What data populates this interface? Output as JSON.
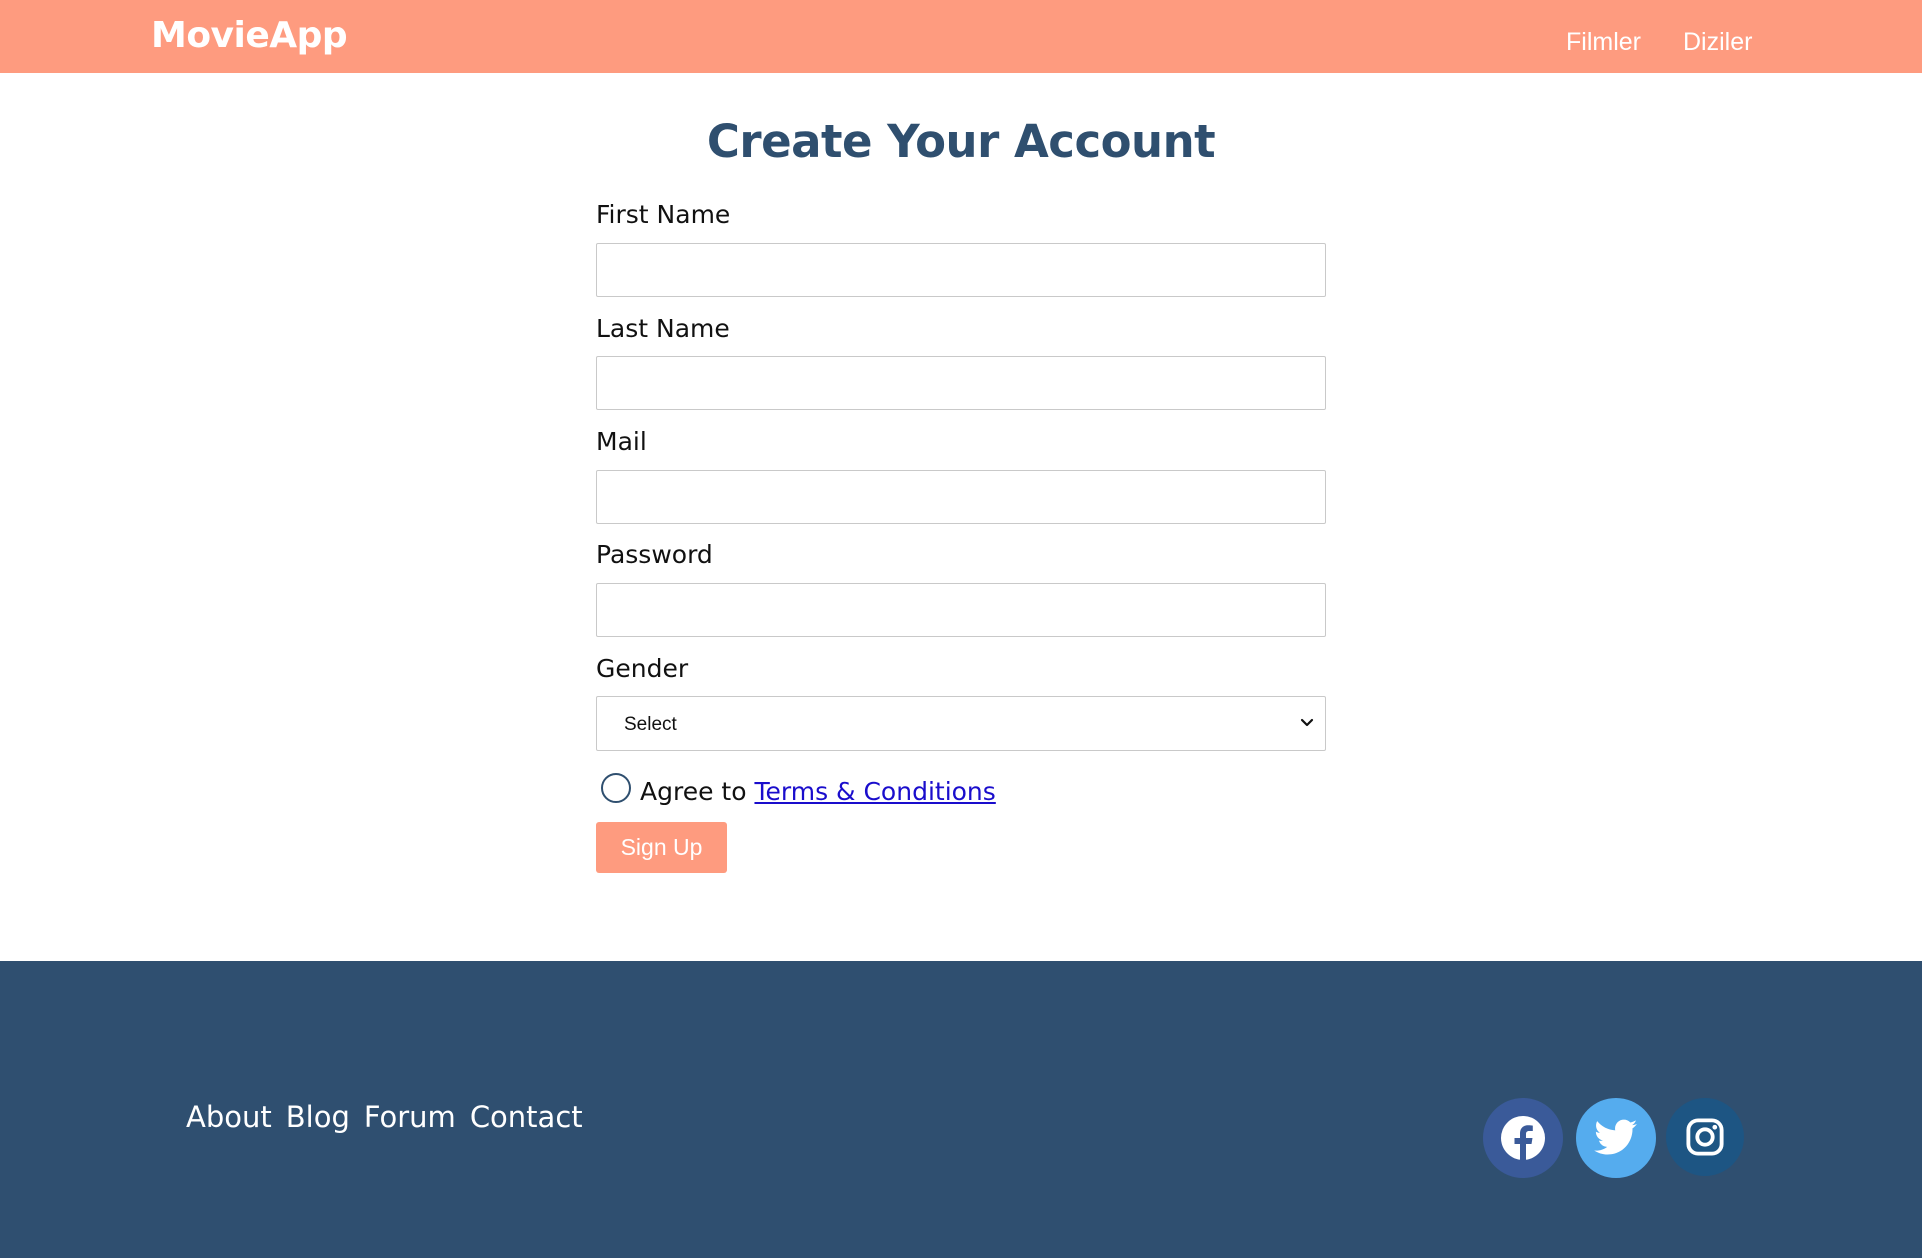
{
  "header": {
    "brand": "MovieApp",
    "nav": [
      {
        "label": "Filmler"
      },
      {
        "label": "Diziler"
      }
    ],
    "background_color": "#fe9b7f"
  },
  "form": {
    "title": "Create Your Account",
    "fields": [
      {
        "label": "First Name",
        "value": "",
        "placeholder": ""
      },
      {
        "label": "Last Name",
        "value": "",
        "placeholder": ""
      },
      {
        "label": "Mail",
        "value": "",
        "placeholder": ""
      },
      {
        "label": "Password",
        "value": "",
        "placeholder": ""
      }
    ],
    "gender": {
      "label": "Gender",
      "selected": "Select",
      "icon": "chevron-down-icon"
    },
    "agree": {
      "prefix": "Agree to",
      "link_text": "Terms & Conditions",
      "checked": false
    },
    "submit_label": "Sign Up",
    "accent_color": "#fe9b7f",
    "title_color": "#2f4f6f"
  },
  "footer": {
    "links": [
      {
        "label": "About"
      },
      {
        "label": "Blog"
      },
      {
        "label": "Forum"
      },
      {
        "label": "Contact"
      }
    ],
    "social": [
      {
        "icon": "facebook-icon",
        "color": "#3a5a99"
      },
      {
        "icon": "twitter-icon",
        "color": "#55acee"
      },
      {
        "icon": "instagram-icon",
        "color": "#1d5583"
      }
    ],
    "background_color": "#2f4f70"
  }
}
